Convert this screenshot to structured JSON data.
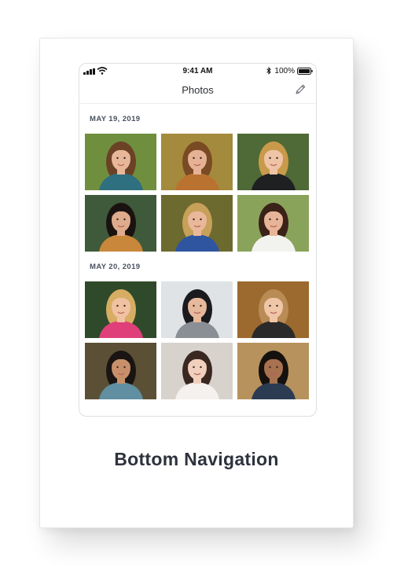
{
  "status_bar": {
    "time": "9:41 AM",
    "battery": "100%"
  },
  "header": {
    "title": "Photos",
    "edit_icon": "pencil-icon"
  },
  "sections": [
    {
      "date": "MAY 19, 2019",
      "photos": [
        {
          "bg": "#6f8f3e",
          "hair": "#6b4226",
          "skin": "#e8b79a",
          "shirt": "#2e6f80"
        },
        {
          "bg": "#a48a3c",
          "hair": "#7a4a24",
          "skin": "#e6b295",
          "shirt": "#b9722f"
        },
        {
          "bg": "#4f6a36",
          "hair": "#c99a4a",
          "skin": "#efc4a6",
          "shirt": "#1e2022"
        },
        {
          "bg": "#3f5a3a",
          "hair": "#1a1210",
          "skin": "#deab8c",
          "shirt": "#c8873a"
        },
        {
          "bg": "#6d6a2f",
          "hair": "#c7a05a",
          "skin": "#e9b89a",
          "shirt": "#2f55a0"
        },
        {
          "bg": "#8aa35a",
          "hair": "#3b2218",
          "skin": "#e8b497",
          "shirt": "#f2f2ee"
        }
      ]
    },
    {
      "date": "MAY 20, 2019",
      "photos": [
        {
          "bg": "#2f4a2a",
          "hair": "#d6ad62",
          "skin": "#f0c2a2",
          "shirt": "#e0407a"
        },
        {
          "bg": "#dfe3e6",
          "hair": "#1b1a1c",
          "skin": "#e6b89c",
          "shirt": "#8a8f96"
        },
        {
          "bg": "#9c6a2e",
          "hair": "#b98b55",
          "skin": "#f0c6a8",
          "shirt": "#2a2a2a"
        },
        {
          "bg": "#5b5035",
          "hair": "#1a1412",
          "skin": "#c8906a",
          "shirt": "#5f8fa0"
        },
        {
          "bg": "#d8d2cc",
          "hair": "#3a2820",
          "skin": "#f1cfbd",
          "shirt": "#f4f1ee"
        },
        {
          "bg": "#b7925c",
          "hair": "#15110e",
          "skin": "#a8714f",
          "shirt": "#2b3b52"
        }
      ]
    }
  ],
  "caption": "Bottom Navigation"
}
